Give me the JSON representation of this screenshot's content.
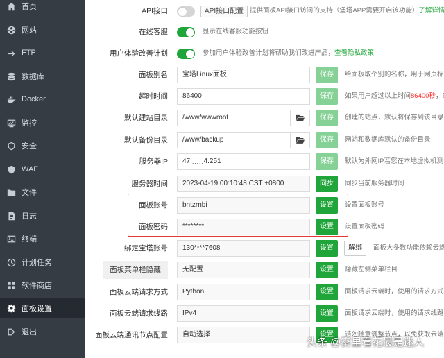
{
  "sidebar": {
    "items": [
      {
        "label": "首页",
        "icon": "home-icon"
      },
      {
        "label": "网站",
        "icon": "globe-icon"
      },
      {
        "label": "FTP",
        "icon": "ftp-icon"
      },
      {
        "label": "数据库",
        "icon": "database-icon"
      },
      {
        "label": "Docker",
        "icon": "docker-icon"
      },
      {
        "label": "监控",
        "icon": "monitor-icon"
      },
      {
        "label": "安全",
        "icon": "shield-icon"
      },
      {
        "label": "WAF",
        "icon": "waf-shield-icon"
      },
      {
        "label": "文件",
        "icon": "folder-icon"
      },
      {
        "label": "日志",
        "icon": "log-icon"
      },
      {
        "label": "终端",
        "icon": "terminal-icon"
      },
      {
        "label": "计划任务",
        "icon": "clock-icon"
      },
      {
        "label": "软件商店",
        "icon": "store-icon"
      },
      {
        "label": "面板设置",
        "icon": "gear-icon",
        "active": true
      },
      {
        "label": "退出",
        "icon": "logout-icon"
      }
    ]
  },
  "settings": {
    "api": {
      "label": "API接口",
      "button": "API接口配置",
      "desc": "提供面板API接口访问的支持（堡塔APP需要开启该功能）",
      "link": "了解详情"
    },
    "online_service": {
      "label": "在线客服",
      "desc": "显示在线客服功能按钮"
    },
    "ux_plan": {
      "label": "用户体验改善计划",
      "desc": "参加用户体验改善计划将帮助我们改进产品，",
      "link": "查看隐私政策"
    },
    "alias": {
      "label": "面板别名",
      "value": "宝塔Linux面板",
      "button": "保存",
      "desc": "给面板取个别的名称，用于网页标题"
    },
    "timeout": {
      "label": "超时时间",
      "value": "86400",
      "button": "保存",
      "desc_prefix": "如果用户超过以上时间",
      "desc_red": "86400秒",
      "desc_suffix": "，未进"
    },
    "site_dir": {
      "label": "默认建站目录",
      "value": "/www/wwwroot",
      "button": "保存",
      "desc": "创建的站点，默认将保存到该目录下"
    },
    "backup_dir": {
      "label": "默认备份目录",
      "value": "/www/backup",
      "button": "保存",
      "desc": "网站和数据库默认的备份目录"
    },
    "server_ip": {
      "label": "服务器IP",
      "value": "47.¸¸¸¸¸4.251",
      "button": "保存",
      "desc": "默认为外网IP若您在本地虚拟机测试"
    },
    "server_time": {
      "label": "服务器时间",
      "value": "2023-04-19 00:10:48 CST +0800",
      "button": "同步",
      "desc": "同步当前服务器时间"
    },
    "account": {
      "label": "面板账号",
      "value": "bntzrnbi",
      "button": "设置",
      "desc": "设置面板账号"
    },
    "password": {
      "label": "面板密码",
      "value": "********",
      "button": "设置",
      "desc": "设置面板密码"
    },
    "bind_account": {
      "label": "绑定宝塔账号",
      "value": "130****7608",
      "button": "设置",
      "unbind": "解绑",
      "desc": "面板大多数功能依赖云端"
    },
    "menu_hide": {
      "label": "面板菜单栏隐藏",
      "value": "无配置",
      "button": "设置",
      "desc": "隐藏左侧菜单栏目"
    },
    "cloud_method": {
      "label": "面板云端请求方式",
      "value": "Python",
      "button": "设置",
      "desc": "面板请求云端时，使用的请求方式，"
    },
    "cloud_line": {
      "label": "面板云端请求线路",
      "value": "IPv4",
      "button": "设置",
      "desc": "面板请求云端时，使用的请求线路，"
    },
    "cloud_node": {
      "label": "面板云端通讯节点配置",
      "value": "自动选择",
      "button": "设置",
      "desc": "请勿随意调整节点，以免获取云端"
    }
  },
  "colors": {
    "accent": "#20a53a",
    "sidebar": "#353c44",
    "highlight": "#e53935"
  },
  "watermark": "头条 @雾里看花最是迷人"
}
